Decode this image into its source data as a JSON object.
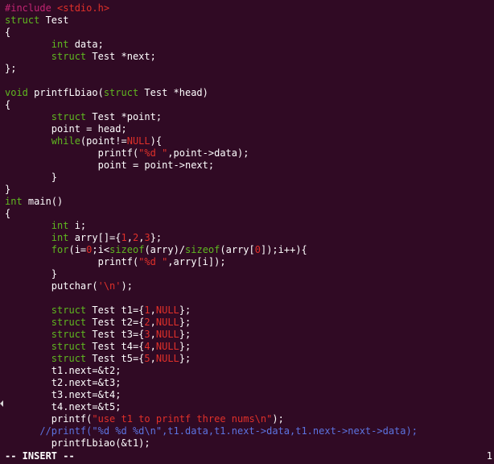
{
  "editor": {
    "lines": [
      [
        {
          "t": "#include ",
          "c": "pre"
        },
        {
          "t": "<stdio.h>",
          "c": "str"
        }
      ],
      [
        {
          "t": "struct",
          "c": "ty"
        },
        {
          "t": " Test",
          "c": ""
        }
      ],
      [
        {
          "t": "{",
          "c": ""
        }
      ],
      [
        {
          "t": "        ",
          "c": ""
        },
        {
          "t": "int",
          "c": "ty"
        },
        {
          "t": " data;",
          "c": ""
        }
      ],
      [
        {
          "t": "        ",
          "c": ""
        },
        {
          "t": "struct",
          "c": "ty"
        },
        {
          "t": " Test *next;",
          "c": ""
        }
      ],
      [
        {
          "t": "};",
          "c": ""
        }
      ],
      [],
      [
        {
          "t": "void",
          "c": "ty"
        },
        {
          "t": " printfLbiao(",
          "c": ""
        },
        {
          "t": "struct",
          "c": "ty"
        },
        {
          "t": " Test *head)",
          "c": ""
        }
      ],
      [
        {
          "t": "{",
          "c": ""
        }
      ],
      [
        {
          "t": "        ",
          "c": ""
        },
        {
          "t": "struct",
          "c": "ty"
        },
        {
          "t": " Test *point;",
          "c": ""
        }
      ],
      [
        {
          "t": "        point = head;",
          "c": ""
        }
      ],
      [
        {
          "t": "        ",
          "c": ""
        },
        {
          "t": "while",
          "c": "kw"
        },
        {
          "t": "(point!=",
          "c": ""
        },
        {
          "t": "NULL",
          "c": "num"
        },
        {
          "t": "){",
          "c": ""
        }
      ],
      [
        {
          "t": "                printf(",
          "c": ""
        },
        {
          "t": "\"%d \"",
          "c": "str"
        },
        {
          "t": ",point->data);",
          "c": ""
        }
      ],
      [
        {
          "t": "                point = point->next;",
          "c": ""
        }
      ],
      [
        {
          "t": "        }",
          "c": ""
        }
      ],
      [
        {
          "t": "}",
          "c": ""
        }
      ],
      [
        {
          "t": "int",
          "c": "ty"
        },
        {
          "t": " main()",
          "c": ""
        }
      ],
      [
        {
          "t": "{",
          "c": ""
        }
      ],
      [
        {
          "t": "        ",
          "c": ""
        },
        {
          "t": "int",
          "c": "ty"
        },
        {
          "t": " i;",
          "c": ""
        }
      ],
      [
        {
          "t": "        ",
          "c": ""
        },
        {
          "t": "int",
          "c": "ty"
        },
        {
          "t": " arry[]={",
          "c": ""
        },
        {
          "t": "1",
          "c": "num"
        },
        {
          "t": ",",
          "c": ""
        },
        {
          "t": "2",
          "c": "num"
        },
        {
          "t": ",",
          "c": ""
        },
        {
          "t": "3",
          "c": "num"
        },
        {
          "t": "};",
          "c": ""
        }
      ],
      [
        {
          "t": "        ",
          "c": ""
        },
        {
          "t": "for",
          "c": "kw"
        },
        {
          "t": "(i=",
          "c": ""
        },
        {
          "t": "0",
          "c": "num"
        },
        {
          "t": ";i<",
          "c": ""
        },
        {
          "t": "sizeof",
          "c": "kw"
        },
        {
          "t": "(arry)/",
          "c": ""
        },
        {
          "t": "sizeof",
          "c": "kw"
        },
        {
          "t": "(arry[",
          "c": ""
        },
        {
          "t": "0",
          "c": "num"
        },
        {
          "t": "]);i++){",
          "c": ""
        }
      ],
      [
        {
          "t": "                printf(",
          "c": ""
        },
        {
          "t": "\"%d \"",
          "c": "str"
        },
        {
          "t": ",arry[i]);",
          "c": ""
        }
      ],
      [
        {
          "t": "        }",
          "c": ""
        }
      ],
      [
        {
          "t": "        putchar(",
          "c": ""
        },
        {
          "t": "'\\n'",
          "c": "str"
        },
        {
          "t": ");",
          "c": ""
        }
      ],
      [],
      [
        {
          "t": "        ",
          "c": ""
        },
        {
          "t": "struct",
          "c": "ty"
        },
        {
          "t": " Test t1={",
          "c": ""
        },
        {
          "t": "1",
          "c": "num"
        },
        {
          "t": ",",
          "c": ""
        },
        {
          "t": "NULL",
          "c": "num"
        },
        {
          "t": "};",
          "c": ""
        }
      ],
      [
        {
          "t": "        ",
          "c": ""
        },
        {
          "t": "struct",
          "c": "ty"
        },
        {
          "t": " Test t2={",
          "c": ""
        },
        {
          "t": "2",
          "c": "num"
        },
        {
          "t": ",",
          "c": ""
        },
        {
          "t": "NULL",
          "c": "num"
        },
        {
          "t": "};",
          "c": ""
        }
      ],
      [
        {
          "t": "        ",
          "c": ""
        },
        {
          "t": "struct",
          "c": "ty"
        },
        {
          "t": " Test t3={",
          "c": ""
        },
        {
          "t": "3",
          "c": "num"
        },
        {
          "t": ",",
          "c": ""
        },
        {
          "t": "NULL",
          "c": "num"
        },
        {
          "t": "};",
          "c": ""
        }
      ],
      [
        {
          "t": "        ",
          "c": ""
        },
        {
          "t": "struct",
          "c": "ty"
        },
        {
          "t": " Test t4={",
          "c": ""
        },
        {
          "t": "4",
          "c": "num"
        },
        {
          "t": ",",
          "c": ""
        },
        {
          "t": "NULL",
          "c": "num"
        },
        {
          "t": "};",
          "c": ""
        }
      ],
      [
        {
          "t": "        ",
          "c": ""
        },
        {
          "t": "struct",
          "c": "ty"
        },
        {
          "t": " Test t5={",
          "c": ""
        },
        {
          "t": "5",
          "c": "num"
        },
        {
          "t": ",",
          "c": ""
        },
        {
          "t": "NULL",
          "c": "num"
        },
        {
          "t": "};",
          "c": ""
        }
      ],
      [
        {
          "t": "        t1.next=&t2;",
          "c": ""
        }
      ],
      [
        {
          "t": "        t2.next=&t3;",
          "c": ""
        }
      ],
      [
        {
          "t": "        t3.next=&t4;",
          "c": ""
        }
      ],
      [
        {
          "t": "        t4.next=&t5;",
          "c": ""
        }
      ],
      [
        {
          "t": "        printf(",
          "c": ""
        },
        {
          "t": "\"use t1 to printf three nums\\n\"",
          "c": "str"
        },
        {
          "t": ");",
          "c": ""
        }
      ],
      [
        {
          "t": "      //printf(\"%d %d %d\\n\",t1.data,t1.next->data,t1.next->next->data);",
          "c": "cm"
        }
      ],
      [
        {
          "t": "        printfLbiao(&t1);",
          "c": ""
        }
      ]
    ]
  },
  "status_bar": {
    "mode": "-- INSERT --",
    "ruler": "1"
  },
  "colors": {
    "background": "#300a24",
    "type_keyword": "#5fb820",
    "string_literal": "#e0302a",
    "preprocessor": "#c22573",
    "comment": "#5c73e0"
  }
}
